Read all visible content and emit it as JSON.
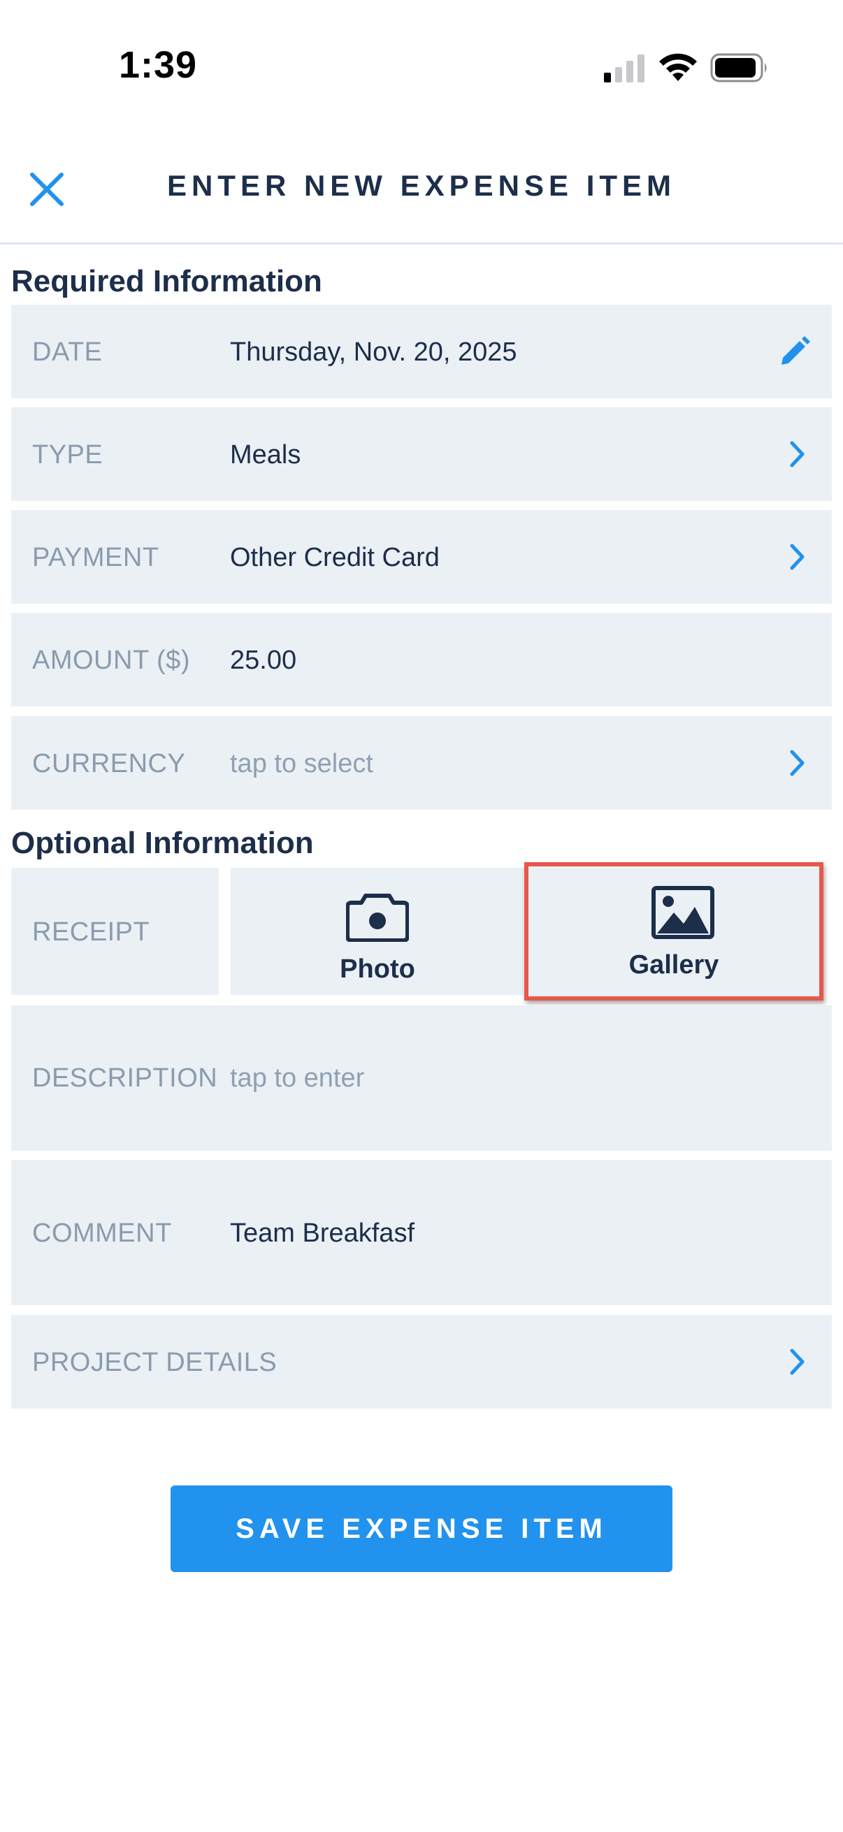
{
  "status_bar": {
    "time": "1:39"
  },
  "header": {
    "title": "ENTER NEW EXPENSE ITEM"
  },
  "sections": {
    "required_title": "Required Information",
    "optional_title": "Optional Information"
  },
  "required": {
    "date": {
      "label": "DATE",
      "value": "Thursday, Nov. 20, 2025"
    },
    "type": {
      "label": "TYPE",
      "value": "Meals"
    },
    "payment": {
      "label": "PAYMENT",
      "value": "Other Credit Card"
    },
    "amount": {
      "label": "AMOUNT ($)",
      "value": "25.00"
    },
    "currency": {
      "label": "CURRENCY",
      "placeholder": "tap to select"
    }
  },
  "optional": {
    "receipt": {
      "label": "RECEIPT",
      "photo_label": "Photo",
      "gallery_label": "Gallery"
    },
    "description": {
      "label": "DESCRIPTION",
      "placeholder": "tap to enter"
    },
    "comment": {
      "label": "COMMENT",
      "value": "Team Breakfasf"
    },
    "project_details": {
      "label": "PROJECT DETAILS"
    }
  },
  "save_button": {
    "label": "SAVE EXPENSE ITEM"
  },
  "icons": {
    "close": "close-icon",
    "pencil": "pencil-icon",
    "chevron": "chevron-right-icon",
    "camera": "camera-icon",
    "gallery": "image-icon"
  },
  "colors": {
    "accent": "#2192ee",
    "text_dark": "#1c2e4a",
    "label_gray": "#8a9bad",
    "row_bg": "#ebf0f5",
    "highlight": "#e8574a"
  }
}
